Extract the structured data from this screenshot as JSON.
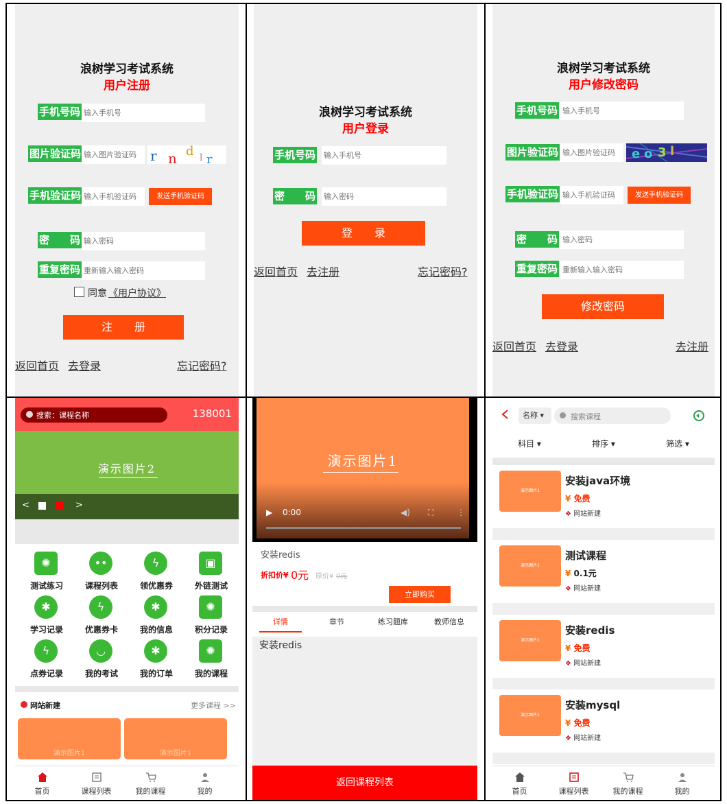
{
  "register": {
    "system_title": "浪树学习考试系统",
    "subtitle": "用户注册",
    "phone_label": "手机号码",
    "phone_placeholder": "输入手机号",
    "img_code_label": "图片验证码",
    "img_code_placeholder": "输入图片验证码",
    "captcha_text": "r n d r",
    "sms_label": "手机验证码",
    "sms_placeholder": "输入手机验证码",
    "send_sms": "发送手机验证码",
    "pwd_label": "密　　码",
    "pwd_placeholder": "输入密码",
    "repeat_label": "重复密码",
    "repeat_placeholder": "重新输入输入密码",
    "agree_text": "同意",
    "agreement_link": "《用户协议》",
    "submit": "注　　册",
    "back_home": "返回首页",
    "go_login": "去登录",
    "forgot": "忘记密码?"
  },
  "login": {
    "system_title": "浪树学习考试系统",
    "subtitle": "用户登录",
    "phone_label": "手机号码",
    "phone_placeholder": "输入手机号",
    "pwd_label": "密　　码",
    "pwd_placeholder": "输入密码",
    "submit": "登　　录",
    "back_home": "返回首页",
    "go_register": "去注册",
    "forgot": "忘记密码?"
  },
  "reset": {
    "system_title": "浪树学习考试系统",
    "subtitle": "用户修改密码",
    "phone_label": "手机号码",
    "phone_placeholder": "输入手机号",
    "img_code_label": "图片验证码",
    "img_code_placeholder": "输入图片验证码",
    "captcha_text": "eo3l",
    "sms_label": "手机验证码",
    "sms_placeholder": "输入手机验证码",
    "send_sms": "发送手机验证码",
    "pwd_label": "密　　码",
    "pwd_placeholder": "输入密码",
    "repeat_label": "重复密码",
    "repeat_placeholder": "重新输入输入密码",
    "submit": "修改密码",
    "back_home": "返回首页",
    "go_login": "去登录",
    "go_register": "去注册"
  },
  "home": {
    "search_text": "搜索：课程名称",
    "user_id": "138001",
    "banner_text": "演示图片2",
    "banner_prev": "<",
    "banner_next": ">",
    "grid": [
      {
        "label": "测试练习",
        "color": "#3cb934"
      },
      {
        "label": "课程列表",
        "color": "#3cb934"
      },
      {
        "label": "领优惠券",
        "color": "#3cb934"
      },
      {
        "label": "外链测试",
        "color": "#3cb934"
      },
      {
        "label": "学习记录",
        "color": "#3cb934"
      },
      {
        "label": "优惠券卡",
        "color": "#3cb934"
      },
      {
        "label": "我的信息",
        "color": "#3cb934"
      },
      {
        "label": "积分记录",
        "color": "#3cb934"
      },
      {
        "label": "点券记录",
        "color": "#3cb934"
      },
      {
        "label": "我的考试",
        "color": "#3cb934"
      },
      {
        "label": "我的订单",
        "color": "#3cb934"
      },
      {
        "label": "我的课程",
        "color": "#3cb934"
      }
    ],
    "section_title": "网站新建",
    "more": "更多课程 >>",
    "card1_text": "演示图片1",
    "card2_text": "演示图片1"
  },
  "detail": {
    "video_text": "演示图片1",
    "video_time": "0:00",
    "course_name": "安装redis",
    "discount_label": "折扣价¥",
    "discount_value": "0元",
    "original_label": "原价¥",
    "original_value": "0元",
    "buy": "立即购买",
    "tabs": [
      "详情",
      "章节",
      "练习题库",
      "教师信息"
    ],
    "content": "安装redis",
    "back": "返回课程列表"
  },
  "list": {
    "filter_name": "名称",
    "search_placeholder": "搜索课程",
    "filters": [
      "科目",
      "排序",
      "筛选"
    ],
    "courses": [
      {
        "title": "安装java环境",
        "price": "免费",
        "source": "网站新建",
        "thumb": "演示图片1"
      },
      {
        "title": "测试课程",
        "price": "0.1元",
        "source": "网站新建",
        "thumb": "演示图片1"
      },
      {
        "title": "安装redis",
        "price": "免费",
        "source": "网站新建",
        "thumb": "演示图片1"
      },
      {
        "title": "安装mysql",
        "price": "免费",
        "source": "网站新建",
        "thumb": "演示图片1"
      }
    ]
  },
  "tabbar": {
    "home": "首页",
    "course_list": "课程列表",
    "my_courses": "我的课程",
    "mine": "我的"
  },
  "colors": {
    "accent_orange": "#ff4b0c",
    "label_green": "#2db64a",
    "alert_red": "#ff0000",
    "thumb_orange": "#ff8c4a"
  }
}
